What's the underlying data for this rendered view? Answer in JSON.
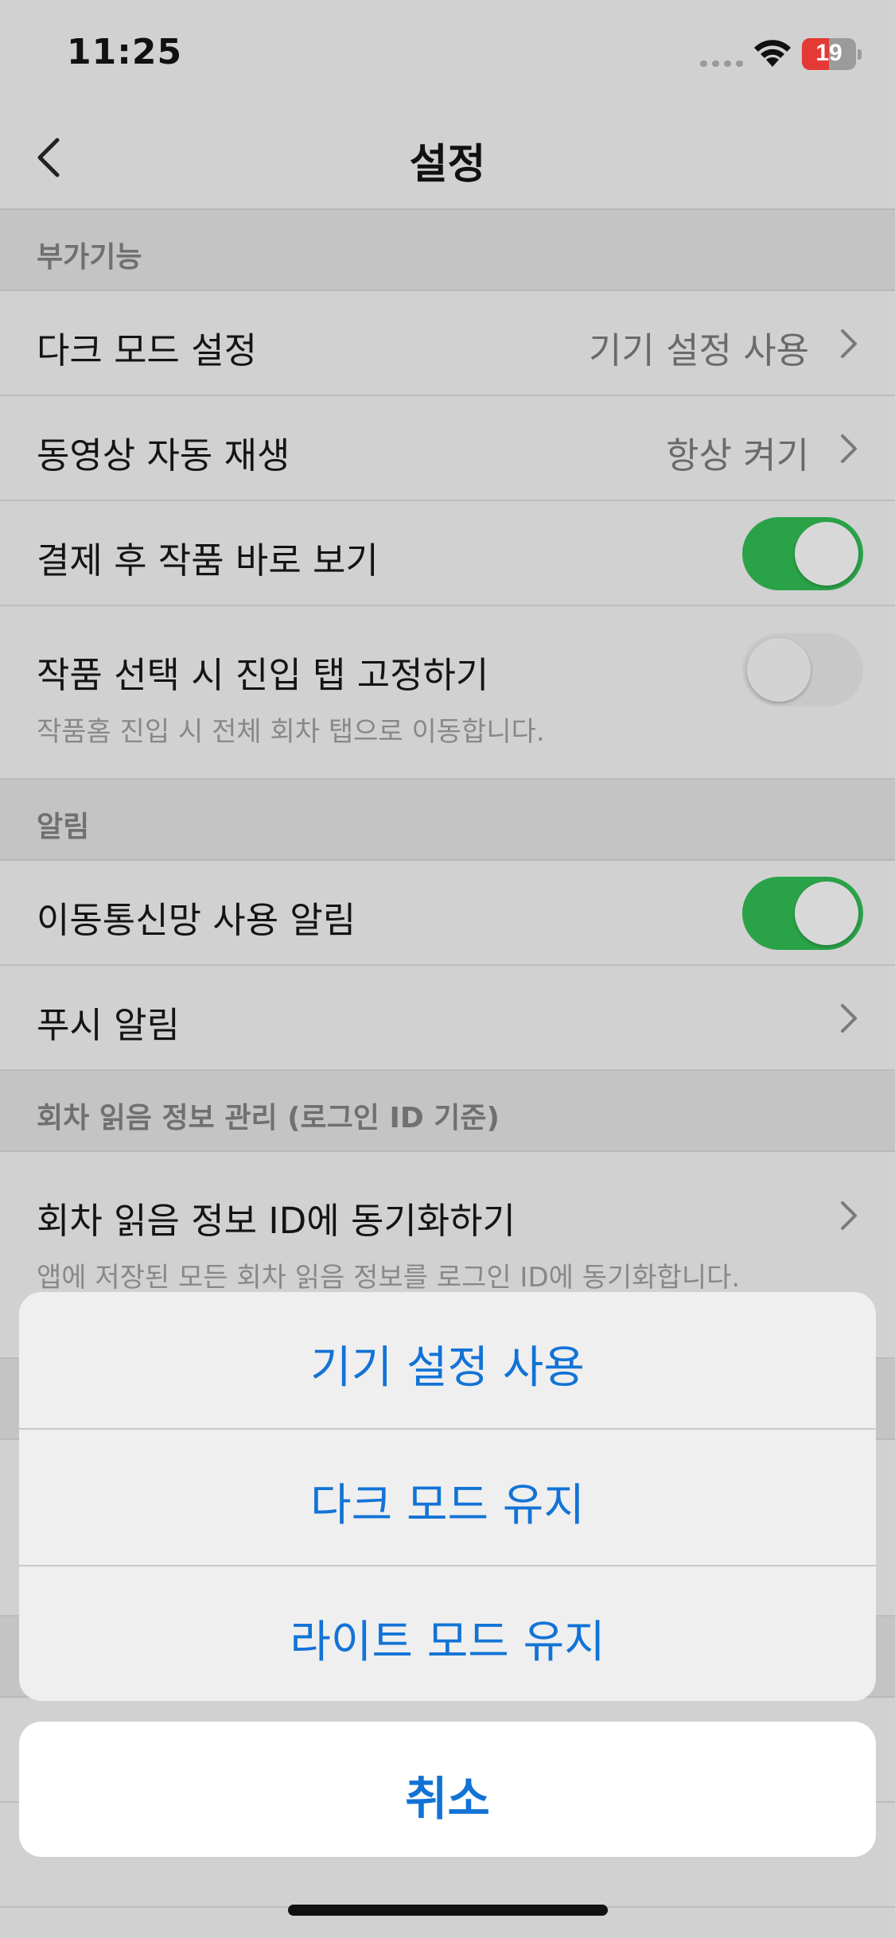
{
  "status_bar": {
    "time": "11:25",
    "battery_level": "19",
    "battery_color": "#e53935"
  },
  "nav": {
    "title": "설정",
    "back_icon": "chevron-left-icon"
  },
  "sections": {
    "extra": {
      "header": "부가기능",
      "dark_mode": {
        "label": "다크 모드 설정",
        "value": "기기 설정 사용"
      },
      "autoplay": {
        "label": "동영상 자동 재생",
        "value": "항상 켜기"
      },
      "view_after_purchase": {
        "label": "결제 후 작품 바로 보기",
        "toggle": "on"
      },
      "fix_tab": {
        "label": "작품 선택 시 진입 탭 고정하기",
        "sub": "작품홈 진입 시 전체 회차 탭으로 이동합니다.",
        "toggle": "off"
      }
    },
    "alerts": {
      "header": "알림",
      "mobile_data": {
        "label": "이동통신망 사용 알림",
        "toggle": "on"
      },
      "push": {
        "label": "푸시 알림"
      }
    },
    "reading": {
      "header": "회차 읽음 정보 관리 (로그인 ID 기준)",
      "sync": {
        "label": "회차 읽음 정보 ID에 동기화하기",
        "sub": "앱에 저장된 모든 회차 읽음 정보를 로그인 ID에 동기화합니다."
      }
    }
  },
  "action_sheet": {
    "options": [
      "기기 설정 사용",
      "다크 모드 유지",
      "라이트 모드 유지"
    ],
    "cancel": "취소"
  },
  "colors": {
    "accent_blue": "#1273d6",
    "toggle_on": "#2aa348"
  }
}
